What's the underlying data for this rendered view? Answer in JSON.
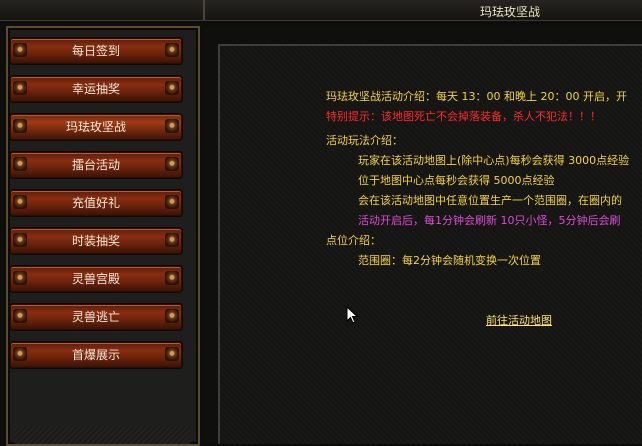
{
  "window": {
    "title": "玛珐玫坚战"
  },
  "sidebar": {
    "items": [
      {
        "label": "每日签到"
      },
      {
        "label": "幸运抽奖"
      },
      {
        "label": "玛珐玫坚战"
      },
      {
        "label": "擂台活动"
      },
      {
        "label": "充值好礼"
      },
      {
        "label": "时装抽奖"
      },
      {
        "label": "灵兽宫殿"
      },
      {
        "label": "灵兽逃亡"
      },
      {
        "label": "首爆展示"
      }
    ]
  },
  "content": {
    "intro": "玛珐玫坚战活动介绍：每天 13：00 和晚上 20：00 开启，开",
    "warning": "特别提示：该地图死亡不会掉落装备，杀人不犯法！！！",
    "gameplay_heading": "活动玩法介绍：",
    "gameplay_lines": [
      "玩家在该活动地图上(除中心点)每秒会获得 3000点经验",
      "位于地图中心点每秒会获得 5000点经验",
      "会在该活动地图中任意位置生产一个范围圈，在圈内的",
      "活动开启后，每1分钟会刷新 10只小怪，5分钟后会刷"
    ],
    "points_heading": "点位介绍：",
    "points_lines": [
      "范围圈：每2分钟会随机变换一次位置"
    ],
    "goto_link": "前往活动地图"
  },
  "colors": {
    "text_yellow": "#f5d33a",
    "text_red": "#ff2a2a",
    "text_magenta": "#e04ad8",
    "button_red": "#8a2d10"
  }
}
